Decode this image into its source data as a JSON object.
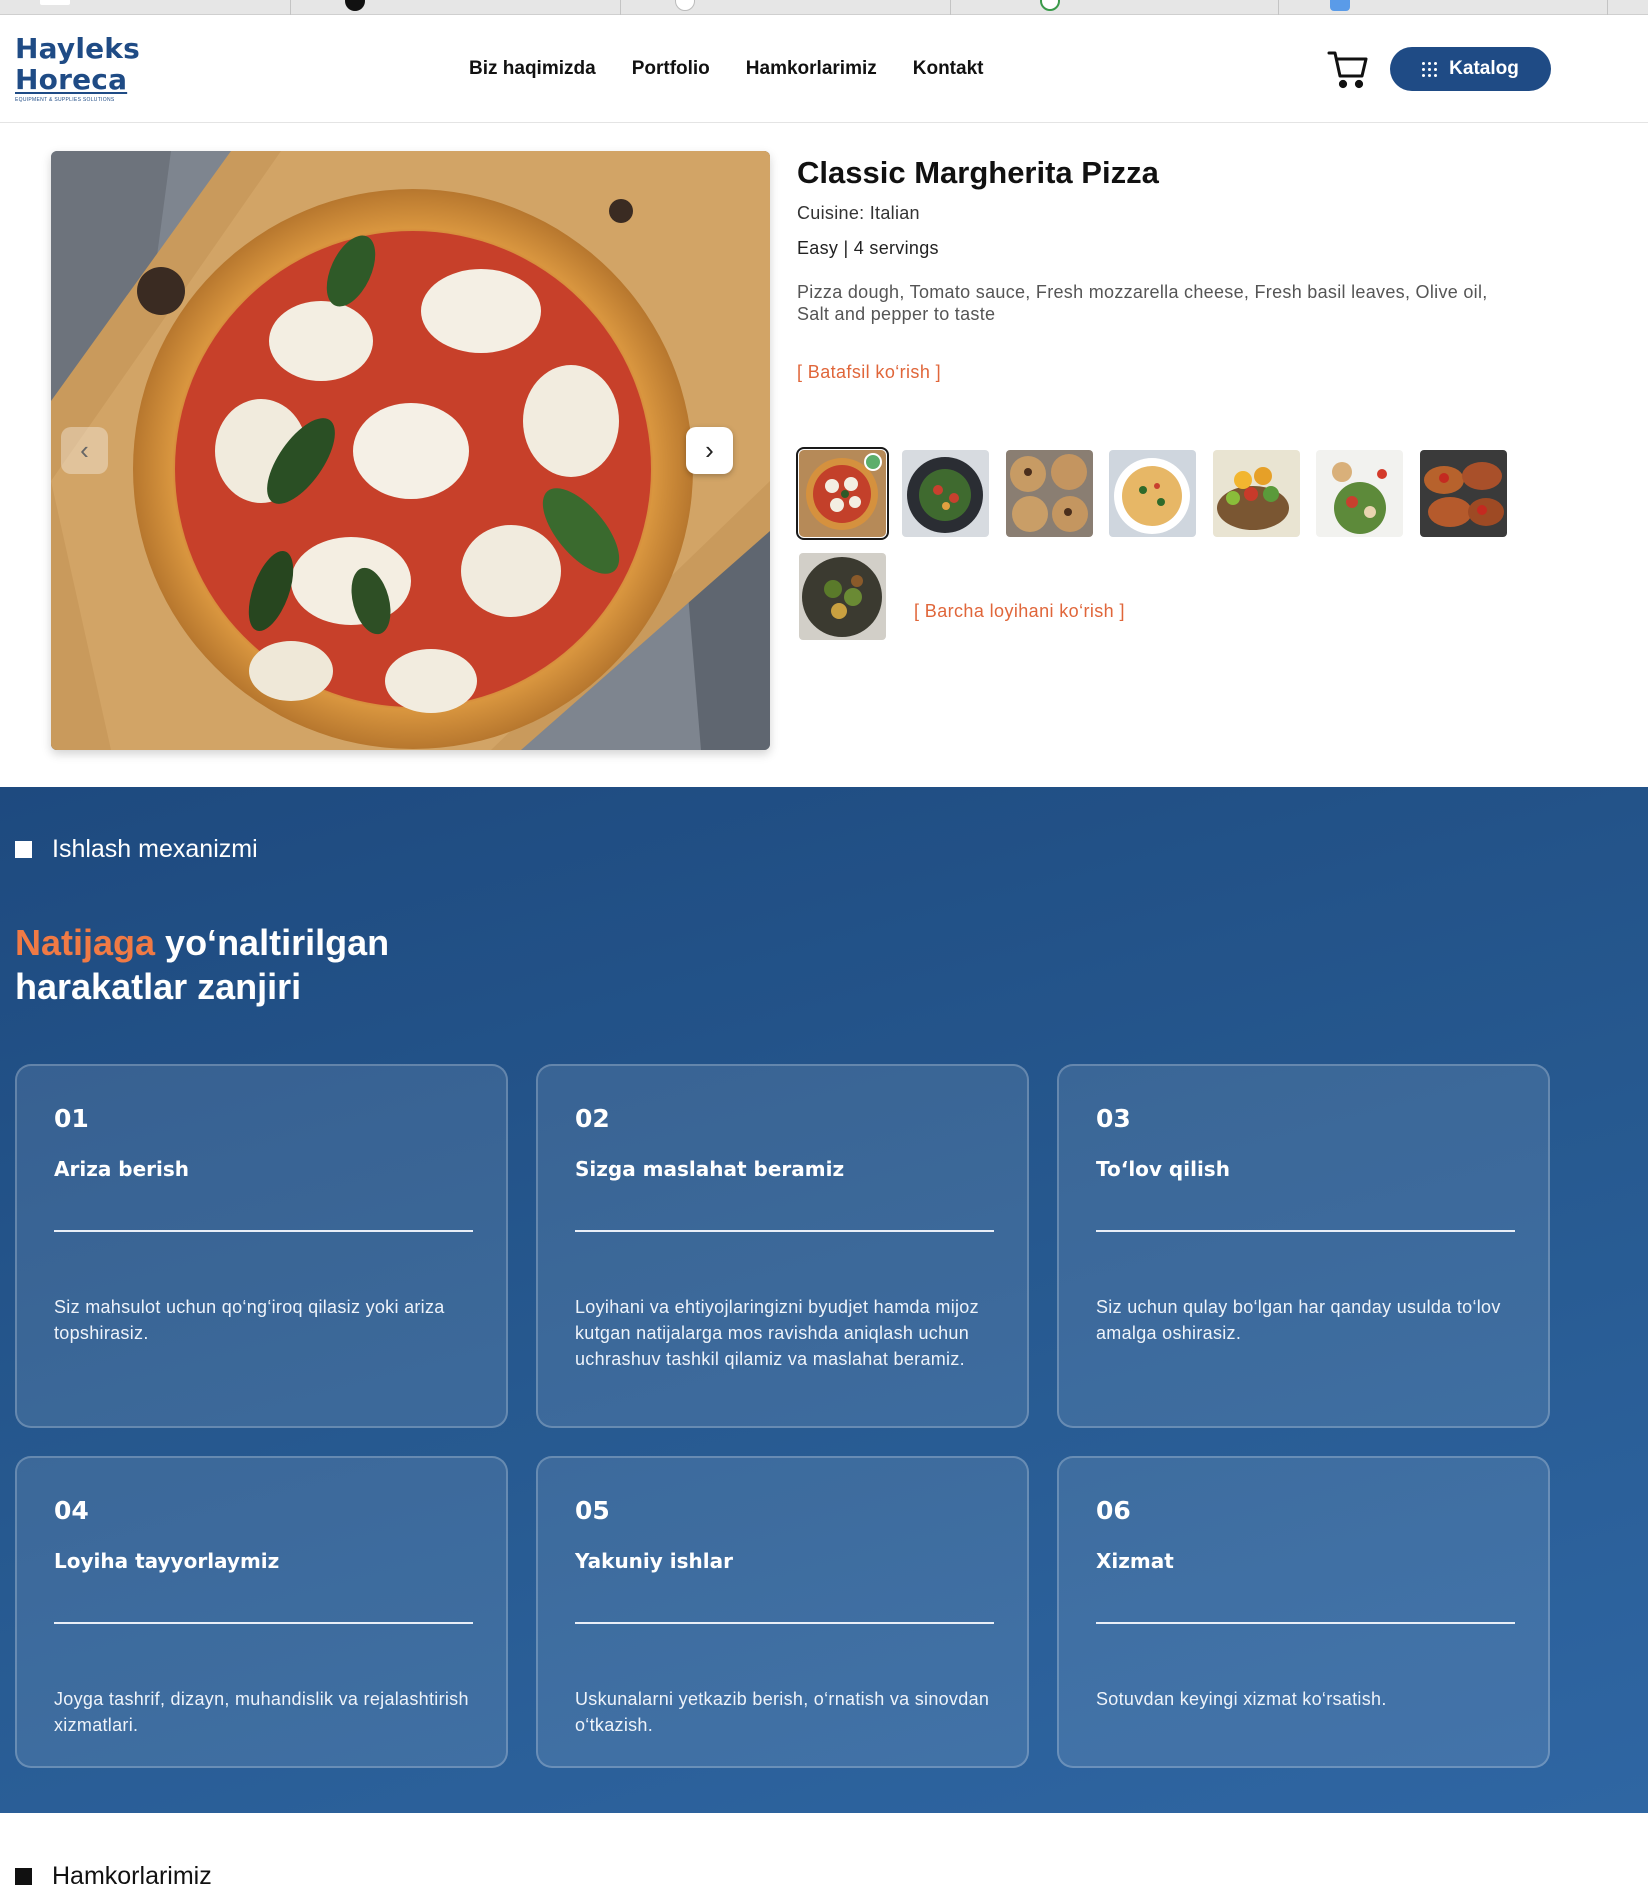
{
  "brand": {
    "name_line1": "Hayleks",
    "name_line2": "Horeca",
    "tagline": "EQUIPMENT & SUPPLIES SOLUTIONS",
    "color": "#1f4b85"
  },
  "nav": {
    "items": [
      "Biz haqimizda",
      "Portfolio",
      "Hamkorlarimiz",
      "Kontakt"
    ],
    "cart_icon": "cart-icon",
    "catalog_label": "Katalog",
    "catalog_icon": "grid-dots-icon"
  },
  "recipe": {
    "title": "Classic Margherita Pizza",
    "cuisine": "Cuisine: Italian",
    "meta": "Easy | 4 servings",
    "ingredients": "Pizza dough, Tomato sauce, Fresh mozzarella cheese, Fresh basil leaves, Olive oil, Salt and pepper to taste",
    "detail_link": "[ Batafsil ko‘rish ]",
    "all_link": "[ Barcha loyihani ko‘rish ]",
    "prev_icon": "chevron-left-icon",
    "next_icon": "chevron-right-icon",
    "accent_color": "#e0663a",
    "thumbnails": [
      "pizza",
      "salad-bowl",
      "cookies",
      "pasta",
      "mango-salad",
      "veggie-bowl",
      "bruschetta",
      "stir-fry"
    ],
    "active_thumbnail": 0
  },
  "process": {
    "label": "Ishlash mexanizmi",
    "title_accent": "Natijaga",
    "title_rest_line1": " yo‘naltirilgan",
    "title_line2": "harakatlar zanjiri",
    "accent_color": "#f07a45",
    "steps": [
      {
        "num": "01",
        "title": "Ariza berish",
        "desc": "Siz mahsulot uchun qo‘ng‘iroq qilasiz yoki ariza topshirasiz."
      },
      {
        "num": "02",
        "title": "Sizga maslahat beramiz",
        "desc": "Loyihani va ehtiyojlaringizni byudjet hamda mijoz kutgan natijalarga mos ravishda aniqlash uchun uchrashuv tashkil qilamiz va maslahat beramiz."
      },
      {
        "num": "03",
        "title": "To‘lov qilish",
        "desc": "Siz uchun qulay bo‘lgan har qanday usulda to‘lov amalga oshirasiz."
      },
      {
        "num": "04",
        "title": "Loyiha tayyorlaymiz",
        "desc": "Joyga tashrif, dizayn, muhandislik va rejalashtirish xizmatlari."
      },
      {
        "num": "05",
        "title": "Yakuniy ishlar",
        "desc": "Uskunalarni yetkazib berish, o‘rnatish va sinovdan o‘tkazish."
      },
      {
        "num": "06",
        "title": "Xizmat",
        "desc": "Sotuvdan keyingi xizmat ko‘rsatish."
      }
    ]
  },
  "partners": {
    "label": "Hamkorlarimiz"
  }
}
